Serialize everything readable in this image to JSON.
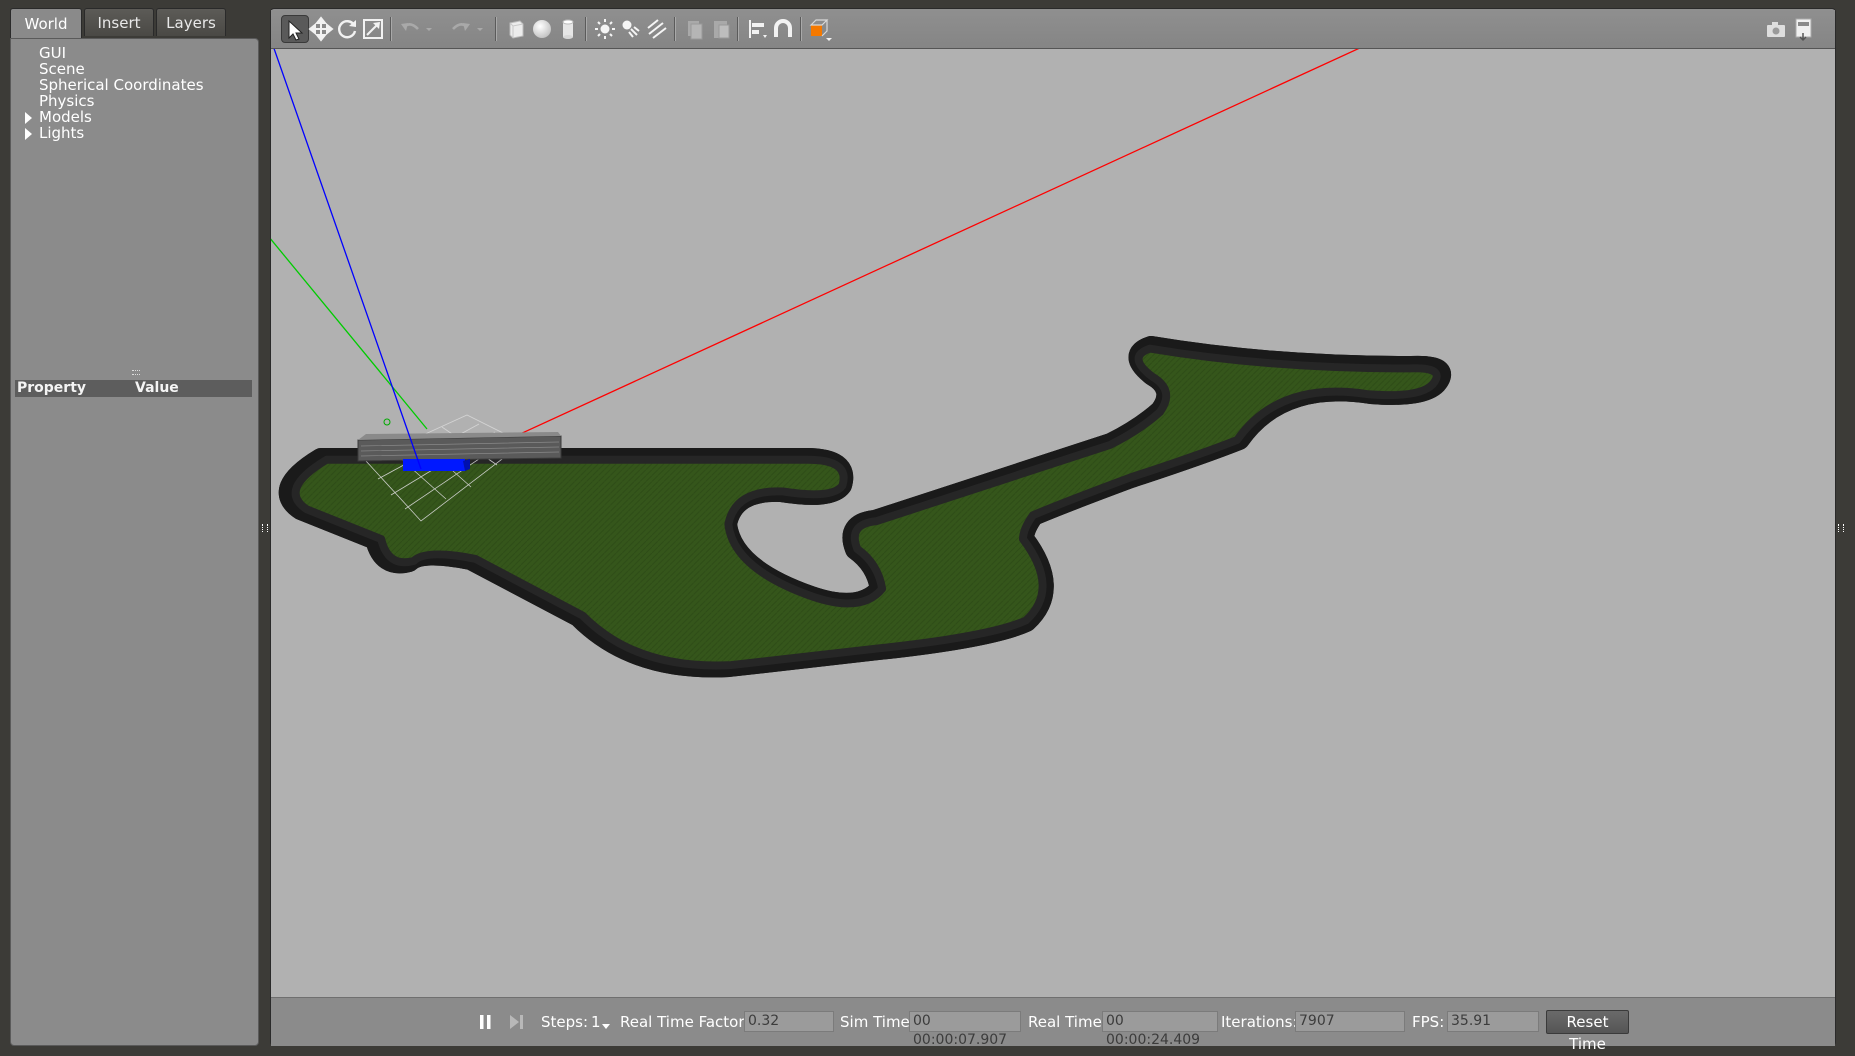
{
  "tabs": [
    {
      "label": "World",
      "active": true
    },
    {
      "label": "Insert",
      "active": false
    },
    {
      "label": "Layers",
      "active": false
    }
  ],
  "tree": {
    "items": [
      {
        "label": "GUI",
        "expandable": false
      },
      {
        "label": "Scene",
        "expandable": false
      },
      {
        "label": "Spherical Coordinates",
        "expandable": false
      },
      {
        "label": "Physics",
        "expandable": false
      },
      {
        "label": "Models",
        "expandable": true
      },
      {
        "label": "Lights",
        "expandable": true
      }
    ]
  },
  "properties": {
    "col_property": "Property",
    "col_value": "Value"
  },
  "toolbar": {
    "tools": [
      "select-mode",
      "translate-mode",
      "rotate-mode",
      "scale-mode",
      "undo",
      "redo",
      "box",
      "sphere",
      "cylinder",
      "point-light",
      "spot-light",
      "directional-light",
      "copy",
      "paste",
      "align",
      "snap",
      "view-angle"
    ],
    "right_tools": [
      "screenshot",
      "log"
    ]
  },
  "bottom_bar": {
    "steps_label": "Steps:",
    "steps_value": "1",
    "rtf_label": "Real Time Factor:",
    "rtf_value": "0.32",
    "sim_time_label": "Sim Time:",
    "sim_time_value": "00 00:00:07.907",
    "real_time_label": "Real Time:",
    "real_time_value": "00 00:00:24.409",
    "iterations_label": "Iterations:",
    "iterations_value": "7907",
    "fps_label": "FPS:",
    "fps_value": "35.91",
    "reset_label": "Reset Time"
  },
  "colors": {
    "viewport_bg": "#b1b1b1",
    "track_surface": "#1a1a1a",
    "grass": "#35561b",
    "x_axis": "#ff0000",
    "y_axis": "#00cc00",
    "z_axis": "#0000ff",
    "accent_orange": "#f57900"
  }
}
